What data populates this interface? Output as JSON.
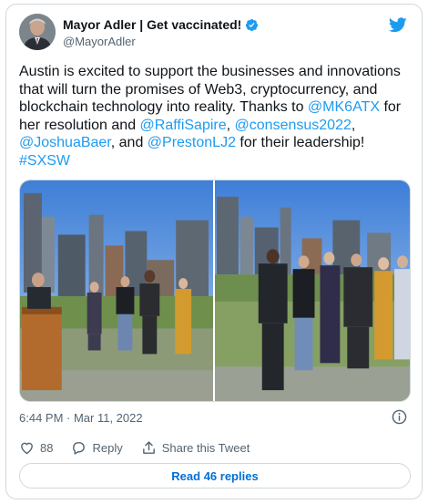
{
  "author": {
    "display_name": "Mayor Adler | Get vaccinated!",
    "handle": "@MayorAdler"
  },
  "tweet": {
    "segments": [
      {
        "text": "Austin is excited to support the businesses and innovations that will turn the promises of Web3, cryptocurrency, and blockchain technology into reality. Thanks to ",
        "link": false
      },
      {
        "text": "@MK6ATX",
        "link": true
      },
      {
        "text": " for her resolution and ",
        "link": false
      },
      {
        "text": "@RaffiSapire",
        "link": true
      },
      {
        "text": ", ",
        "link": false
      },
      {
        "text": "@consensus2022",
        "link": true
      },
      {
        "text": ", ",
        "link": false
      },
      {
        "text": "@JoshuaBaer",
        "link": true
      },
      {
        "text": ", and ",
        "link": false
      },
      {
        "text": "@PrestonLJ2",
        "link": true
      },
      {
        "text": " for their leadership! ",
        "link": false
      },
      {
        "text": "#SXSW",
        "link": true
      }
    ]
  },
  "meta": {
    "timestamp": "6:44 PM · Mar 11, 2022"
  },
  "actions": {
    "likes_count": "88",
    "reply_label": "Reply",
    "share_label": "Share this Tweet"
  },
  "read_replies_label": "Read 46 replies",
  "colors": {
    "link": "#1d9bf0",
    "verified": "#1d9bf0",
    "secondary_text": "#536471",
    "border": "#cfd9de",
    "read_replies_text": "#006fd6"
  },
  "icons": [
    "verified-badge-icon",
    "twitter-bird-icon",
    "info-icon",
    "heart-icon",
    "reply-icon",
    "share-icon"
  ]
}
